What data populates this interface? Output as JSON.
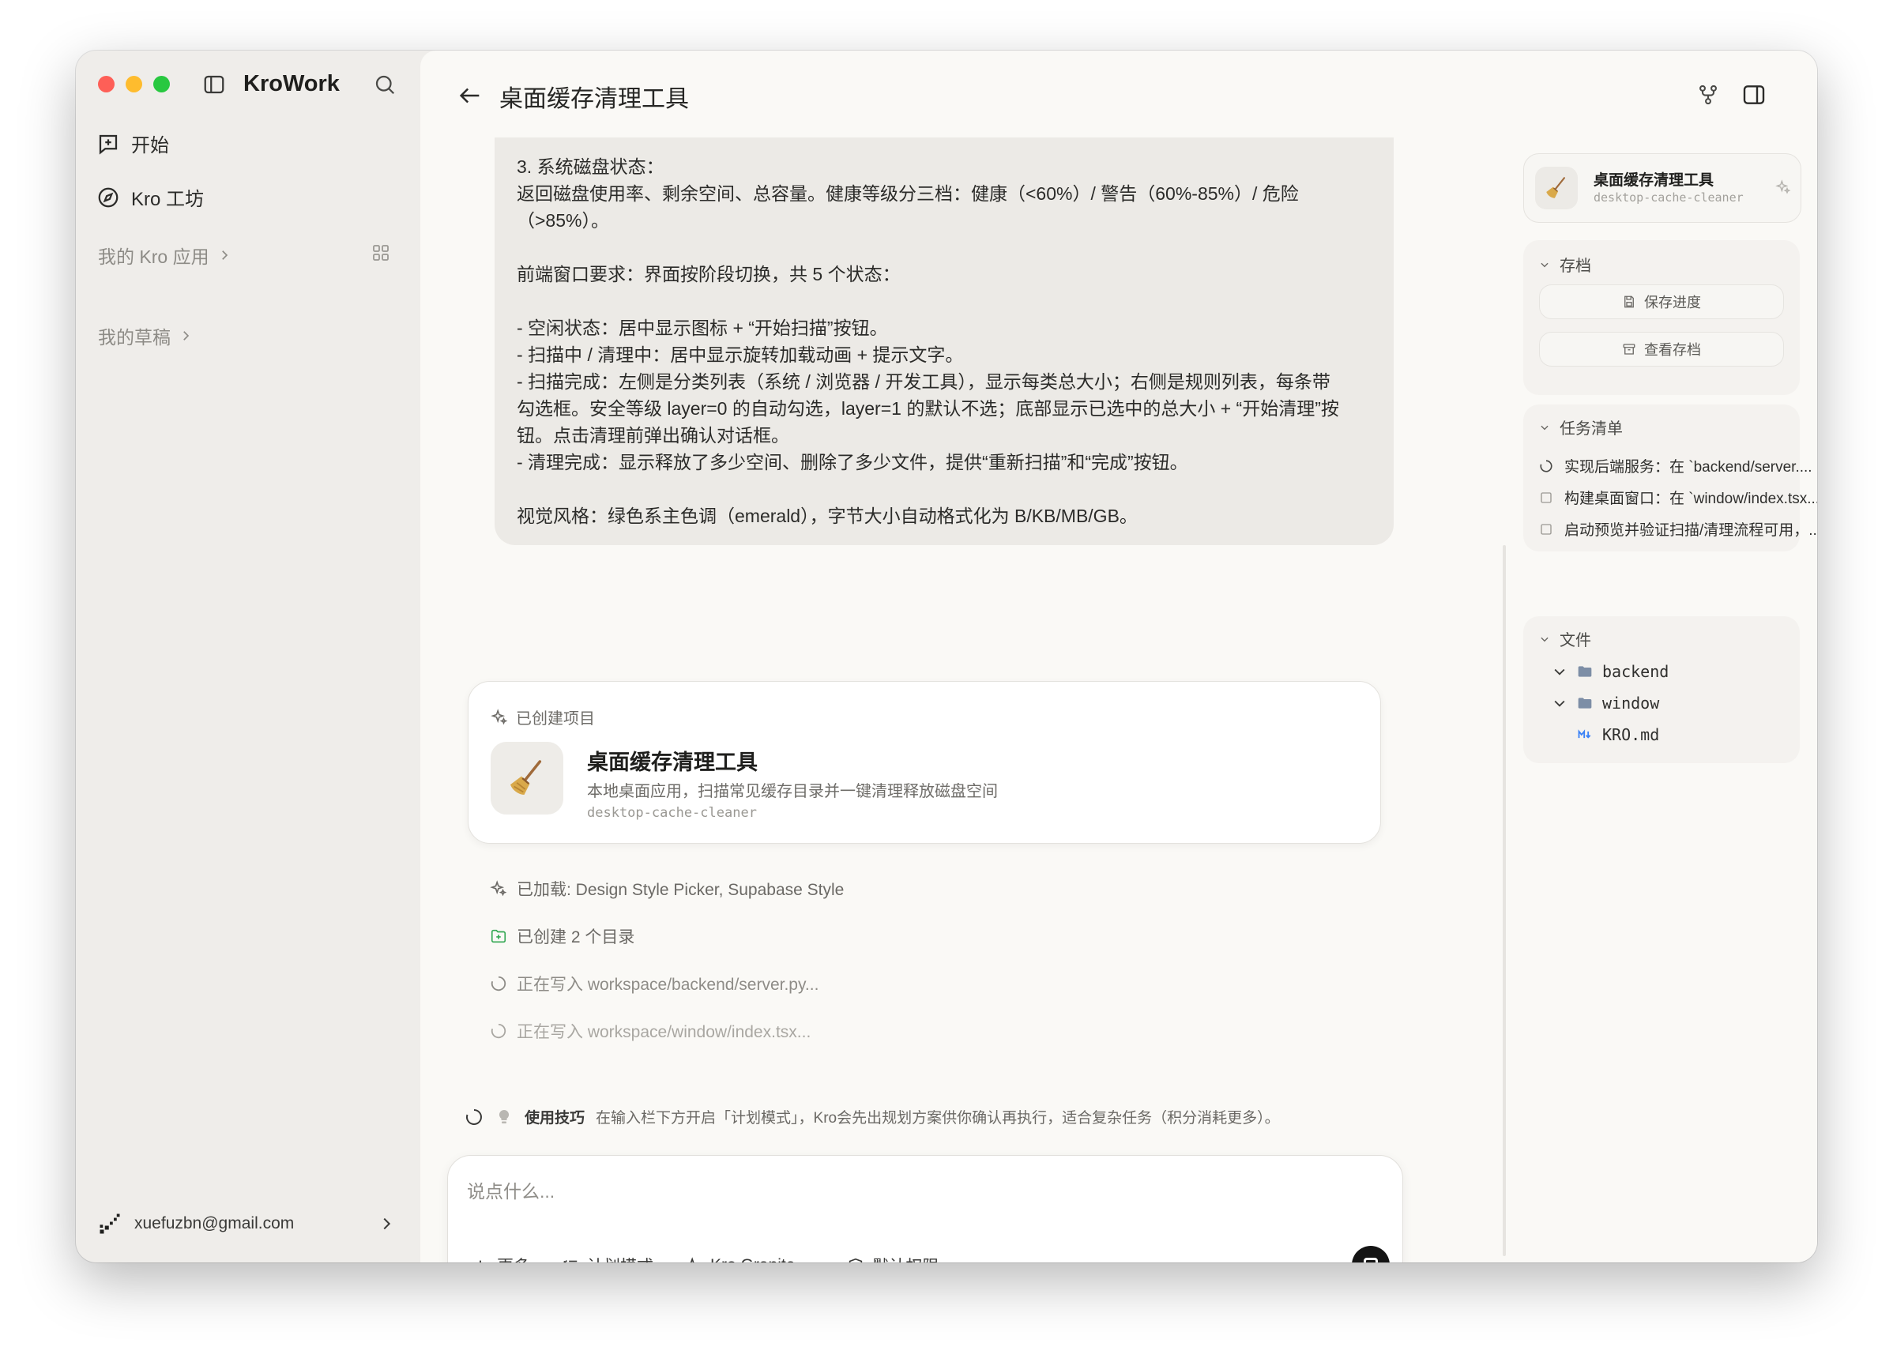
{
  "sidebar": {
    "brand": "KroWork",
    "nav": [
      {
        "label": "开始",
        "icon": "new-chat-icon"
      },
      {
        "label": "Kro 工坊",
        "icon": "compass-icon"
      }
    ],
    "my_apps_label": "我的 Kro 应用",
    "drafts_label": "我的草稿",
    "user_email": "xuefuzbn@gmail.com"
  },
  "header": {
    "title": "桌面缓存清理工具"
  },
  "message": {
    "lines": [
      "3. 系统磁盘状态：",
      "返回磁盘使用率、剩余空间、总容量。健康等级分三档：健康（<60%）/ 警告（60%-85%）/ 危险",
      "（>85%）。",
      "",
      "前端窗口要求：界面按阶段切换，共 5 个状态：",
      "",
      "- 空闲状态：居中显示图标 + “开始扫描”按钮。",
      "- 扫描中 / 清理中：居中显示旋转加载动画 + 提示文字。",
      "- 扫描完成：左侧是分类列表（系统 / 浏览器 / 开发工具），显示每类总大小；右侧是规则列表，每条带",
      "勾选框。安全等级 layer=0 的自动勾选，layer=1 的默认不选；底部显示已选中的总大小 + “开始清理”按",
      "钮。点击清理前弹出确认对话框。",
      "- 清理完成：显示释放了多少空间、删除了多少文件，提供“重新扫描”和“完成”按钮。",
      "",
      "视觉风格：绿色系主色调（emerald），字节大小自动格式化为 B/KB/MB/GB。"
    ]
  },
  "project_card": {
    "header": "已创建项目",
    "title": "桌面缓存清理工具",
    "description": "本地桌面应用，扫描常见缓存目录并一键清理释放磁盘空间",
    "slug": "desktop-cache-cleaner"
  },
  "activities": [
    {
      "text": "已加载: Design Style Picker, Supabase Style",
      "icon": "sparkles-icon",
      "color": "#6b6965"
    },
    {
      "text": "已创建 2 个目录",
      "icon": "folder-plus-icon",
      "color": "#6b6965"
    },
    {
      "text": "正在写入 workspace/backend/server.py...",
      "icon": "spinner-icon",
      "color": "#8e8c87"
    },
    {
      "text": "正在写入 workspace/window/index.tsx...",
      "icon": "spinner-icon",
      "color": "#a9a7a2"
    }
  ],
  "tip": {
    "label": "使用技巧",
    "text": "在输入栏下方开启「计划模式」，Kro会先出规划方案供你确认再执行，适合复杂任务（积分消耗更多）。"
  },
  "composer": {
    "placeholder": "说点什么...",
    "more": "更多",
    "plan_mode": "计划模式",
    "model": "Kro Granite",
    "permission": "默认权限"
  },
  "right_panel": {
    "app_title": "桌面缓存清理工具",
    "app_slug": "desktop-cache-cleaner",
    "archive": {
      "title": "存档",
      "save": "保存进度",
      "view": "查看存档"
    },
    "tasks": {
      "title": "任务清单",
      "items": [
        "实现后端服务：在 `backend/server....",
        "构建桌面窗口：在 `window/index.tsx...",
        "启动预览并验证扫描/清理流程可用，..."
      ]
    },
    "files": {
      "title": "文件",
      "items": [
        "backend",
        "window",
        "KRO.md"
      ]
    }
  },
  "colors": {
    "accent_green": "#34a853",
    "md_blue": "#3b82f6",
    "folder_blue": "#7d8ea6"
  }
}
